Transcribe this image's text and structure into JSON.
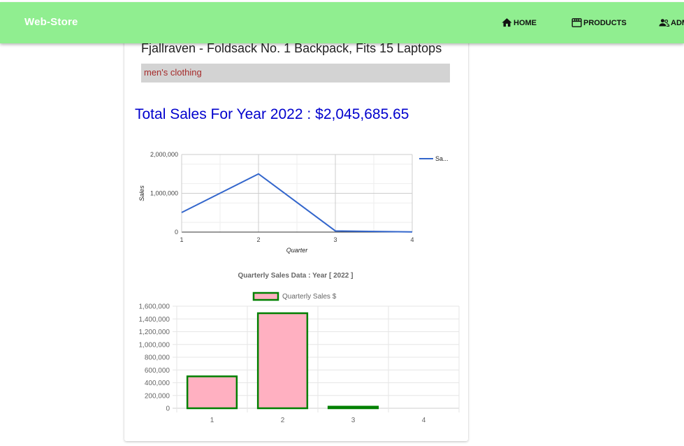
{
  "navbar": {
    "brand": "Web-Store",
    "items": [
      {
        "label": "HOME",
        "icon": "home-icon"
      },
      {
        "label": "PRODUCTS",
        "icon": "store-icon"
      },
      {
        "label": "ADM",
        "icon": "users-icon"
      }
    ]
  },
  "product": {
    "title": "Fjallraven - Foldsack No. 1 Backpack, Fits 15 Laptops",
    "category": "men's clothing"
  },
  "sales": {
    "total_label": "Total Sales For Year 2022 :",
    "total_value": "$2,045,685.65"
  },
  "colors": {
    "navbar": "#90ee90",
    "total_text": "#0000cd",
    "category_text": "#a52a2a",
    "line_series": "#3366cc",
    "bar_fill": "#ffb0c1",
    "bar_border": "#008000"
  },
  "chart_data": [
    {
      "type": "line",
      "x": [
        1,
        2,
        3,
        4
      ],
      "series": [
        {
          "name": "Sa...",
          "values": [
            505000,
            1500000,
            30000,
            5000
          ]
        }
      ],
      "xlabel": "Quarter",
      "ylabel": "Sales",
      "xlim": [
        1,
        4
      ],
      "ylim": [
        0,
        2000000
      ],
      "yticks": [
        "0",
        "1,000,000",
        "2,000,000"
      ],
      "xticks": [
        "1",
        "2",
        "3",
        "4"
      ],
      "grid": true,
      "legend": "right"
    },
    {
      "type": "bar",
      "title": "Quarterly Sales Data  : Year [ 2022 ]",
      "categories": [
        "1",
        "2",
        "3",
        "4"
      ],
      "series": [
        {
          "name": "Quarterly Sales $",
          "values": [
            500000,
            1490000,
            25000,
            0
          ]
        }
      ],
      "ylim": [
        0,
        1600000
      ],
      "yticks": [
        "0",
        "200,000",
        "400,000",
        "600,000",
        "800,000",
        "1,000,000",
        "1,200,000",
        "1,400,000",
        "1,600,000"
      ],
      "grid": true,
      "legend": "top"
    }
  ]
}
